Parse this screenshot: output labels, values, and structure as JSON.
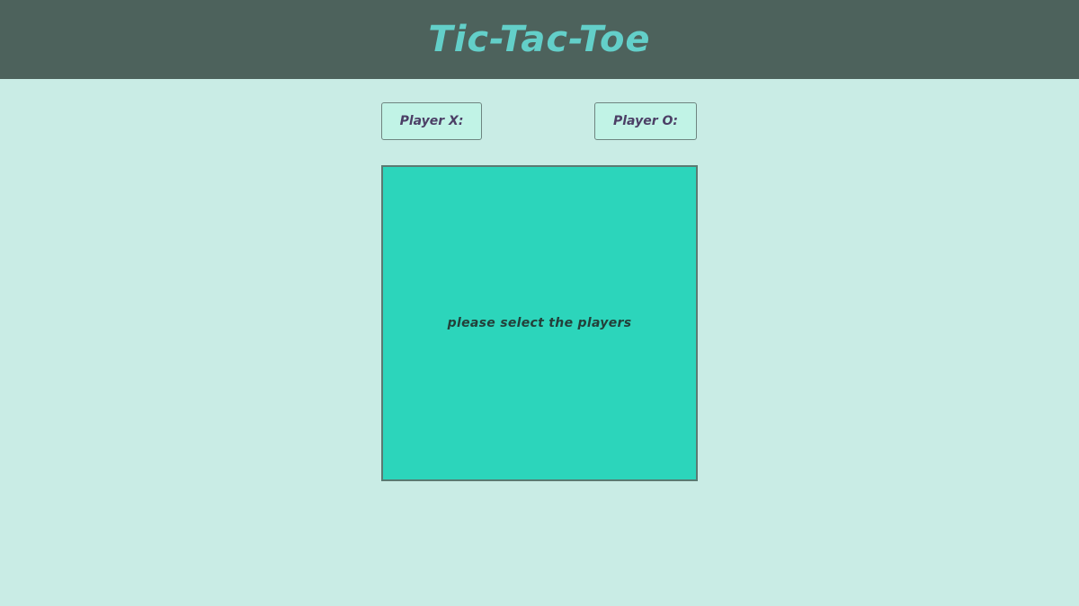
{
  "header": {
    "title": "Tic-Tac-Toe"
  },
  "players": {
    "x_label": "Player X:",
    "o_label": "Player O:"
  },
  "board": {
    "message": "please select the players"
  },
  "colors": {
    "header_bg": "#4d625c",
    "title": "#63cfc9",
    "page_bg": "#c9ece5",
    "board_bg": "#2cd5bb",
    "button_bg": "#c1f3e6",
    "button_text": "#4c3f66"
  }
}
